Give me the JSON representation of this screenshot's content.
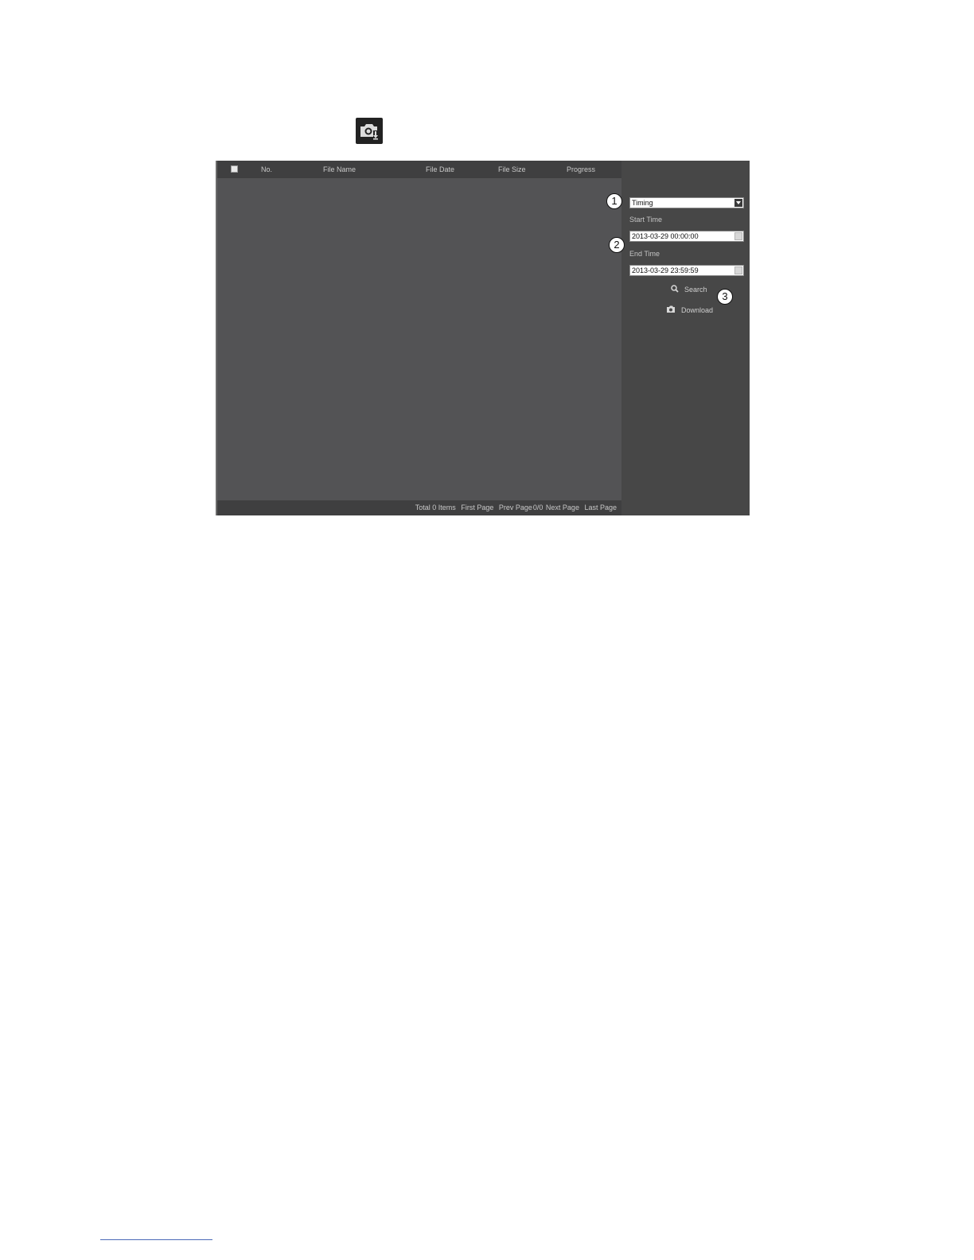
{
  "toolbar": {
    "icon": "camera-download-icon"
  },
  "table": {
    "headers": {
      "no": "No.",
      "file_name": "File Name",
      "file_date": "File Date",
      "file_size": "File Size",
      "progress": "Progress"
    },
    "rows": []
  },
  "pagination": {
    "total": "Total 0 Items",
    "first": "First Page",
    "prev": "Prev Page",
    "page": "0/0",
    "next": "Next Page",
    "last": "Last Page"
  },
  "search": {
    "type_value": "Timing",
    "start_label": "Start Time",
    "start_value": "2013-03-29 00:00:00",
    "end_label": "End Time",
    "end_value": "2013-03-29 23:59:59",
    "search_label": "Search",
    "download_label": "Download"
  },
  "callouts": {
    "one": "1",
    "two": "2",
    "three": "3"
  },
  "colors": {
    "panel_bg": "#454545",
    "table_bg": "#535355",
    "header_bg": "#3f3f40",
    "text": "#c8c8c8"
  }
}
